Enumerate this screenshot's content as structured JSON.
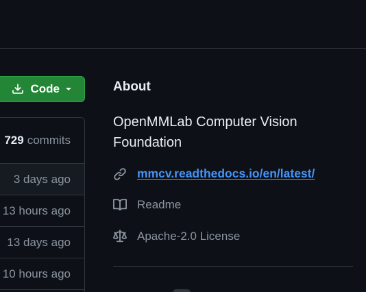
{
  "colors": {
    "background": "#0d1117",
    "border": "#30363d",
    "primary_button": "#238636",
    "link": "#4493f8",
    "muted_text": "#8b949e"
  },
  "code_button": {
    "label": "Code",
    "icon": "download-icon",
    "caret": "triangle-down-icon"
  },
  "commits": {
    "count": "729",
    "label": "commits"
  },
  "files": {
    "times": [
      "3 days ago",
      "13 hours ago",
      "13 days ago",
      "10 hours ago"
    ]
  },
  "about": {
    "title": "About",
    "description": "OpenMMLab Computer Vision Foundation",
    "website": {
      "icon": "link-icon",
      "text": "mmcv.readthedocs.io/en/latest/"
    },
    "readme": {
      "icon": "book-icon",
      "label": "Readme"
    },
    "license": {
      "icon": "law-icon",
      "label": "Apache-2.0 License"
    }
  }
}
